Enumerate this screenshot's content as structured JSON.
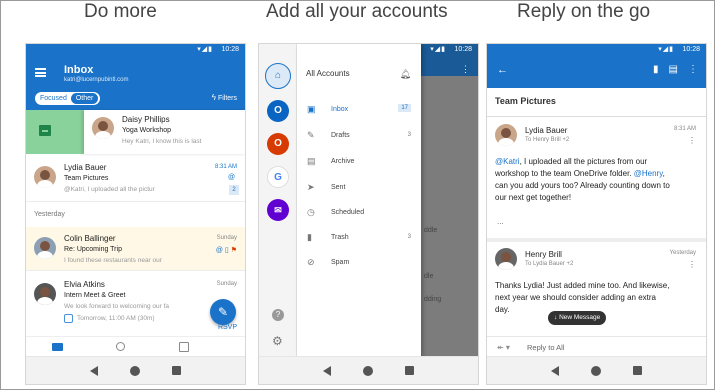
{
  "headings": [
    "Do more",
    "Add all your accounts",
    "Reply on the go"
  ],
  "status_time": "10:28",
  "colors": {
    "brand": "#1a73c9",
    "swipe_green": "#8ad29b"
  },
  "phone1": {
    "title": "Inbox",
    "email": "katri@lucernpubintl.com",
    "tabs": {
      "focused": "Focused",
      "other": "Other"
    },
    "filters": "Filters",
    "mails": [
      {
        "name": "Daisy Phillips",
        "subject": "Yoga Workshop",
        "preview": "Hey Katri, I know this is last",
        "time": ""
      },
      {
        "name": "Lydia Bauer",
        "subject": "Team Pictures",
        "preview": "@Katri, I uploaded all the pictur",
        "time": "8:31 AM",
        "badge_count": "2"
      },
      {
        "name": "Colin Ballinger",
        "subject": "Re: Upcoming Trip",
        "preview": "I found these restaurants near our",
        "time": "Sunday"
      },
      {
        "name": "Elvia Atkins",
        "subject": "Intern Meet & Greet",
        "preview": "We look forward to welcoming our fa",
        "time": "Sunday",
        "event": "Tomorrow, 11:00 AM (30m)",
        "rsvp": "RSVP"
      }
    ],
    "section_yesterday": "Yesterday"
  },
  "phone2": {
    "drawer_title": "All Accounts",
    "folders": [
      {
        "label": "Inbox",
        "count": "17",
        "icon": "inbox-icon",
        "glyph": "▣"
      },
      {
        "label": "Drafts",
        "count": "3",
        "icon": "drafts-icon",
        "glyph": "✎"
      },
      {
        "label": "Archive",
        "count": "",
        "icon": "archive-icon",
        "glyph": "▤"
      },
      {
        "label": "Sent",
        "count": "",
        "icon": "sent-icon",
        "glyph": "➤"
      },
      {
        "label": "Scheduled",
        "count": "",
        "icon": "clock-icon",
        "glyph": "◷"
      },
      {
        "label": "Trash",
        "count": "3",
        "icon": "trash-icon",
        "glyph": "▮"
      },
      {
        "label": "Spam",
        "count": "",
        "icon": "spam-icon",
        "glyph": "⊘"
      }
    ],
    "under_texts": [
      "ddle",
      "dle",
      "dding"
    ],
    "accounts": [
      {
        "icon": "outlook-icon",
        "color": "#0a64c2",
        "glyph": "O"
      },
      {
        "icon": "office-icon",
        "color": "#d83b01",
        "glyph": "O"
      },
      {
        "icon": "google-icon",
        "color": "#ffffff",
        "glyph": "G"
      },
      {
        "icon": "yahoo-icon",
        "color": "#6001d2",
        "glyph": "✉"
      }
    ]
  },
  "phone3": {
    "thread_title": "Team Pictures",
    "messages": [
      {
        "sender": "Lydia Bauer",
        "to": "To Henry Brill +2",
        "time": "8:31 AM",
        "mention": "@Katri",
        "body_a": ", I uploaded all the pictures from our workshop to the team OneDrive folder.",
        "mention2": "@Henry",
        "body_b": ", can you add yours too? Already counting down to our next get together!",
        "more": "..."
      },
      {
        "sender": "Henry Brill",
        "to": "To Lydia Bauer +2",
        "time": "Yesterday",
        "body": "Thanks Lydia! Just added mine too. And likewise, next year we should consider adding an extra day."
      }
    ],
    "new_message": "New Message",
    "reply_all": "Reply to All"
  }
}
